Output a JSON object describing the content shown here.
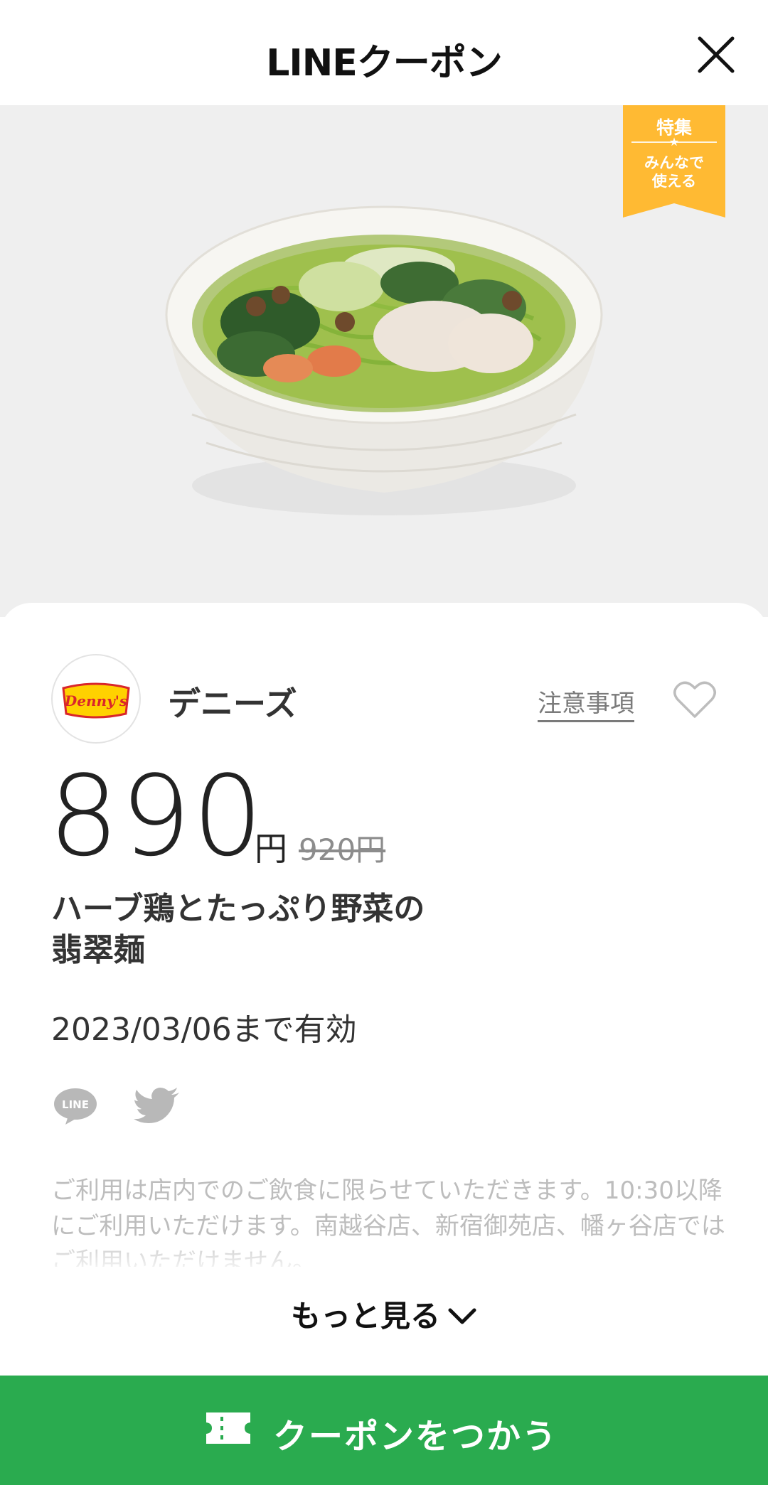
{
  "header": {
    "title": "LINEクーポン",
    "close_icon": "close-icon"
  },
  "badge": {
    "top": "特集",
    "star": "★",
    "bottom": "みんなで\n使える",
    "color": "#ffba33"
  },
  "store": {
    "name": "デニーズ",
    "logo_text": "Denny's",
    "logo_colors": {
      "bg": "#ffd100",
      "text": "#d9262b"
    },
    "notes_label": "注意事項",
    "favorite_icon": "heart-icon"
  },
  "coupon": {
    "price": "890",
    "unit": "円",
    "original_price": "920円",
    "name_line1": "ハーブ鶏とたっぷり野菜の",
    "name_line2": "翡翠麺",
    "validity": "2023/03/06まで有効",
    "description": "ご利用は店内でのご飲食に限らせていただきます。10:30以降にご利用いただけます。南越谷店、新宿御苑店、幡ヶ谷店ではご利用いただけません。"
  },
  "share": {
    "line_icon": "line-share-icon",
    "line_icon_text": "LINE",
    "twitter_icon": "twitter-share-icon"
  },
  "more": {
    "label": "もっと見る",
    "icon": "chevron-down-icon"
  },
  "cta": {
    "label": "クーポンをつかう",
    "icon": "ticket-icon",
    "color": "#2aab4f"
  }
}
